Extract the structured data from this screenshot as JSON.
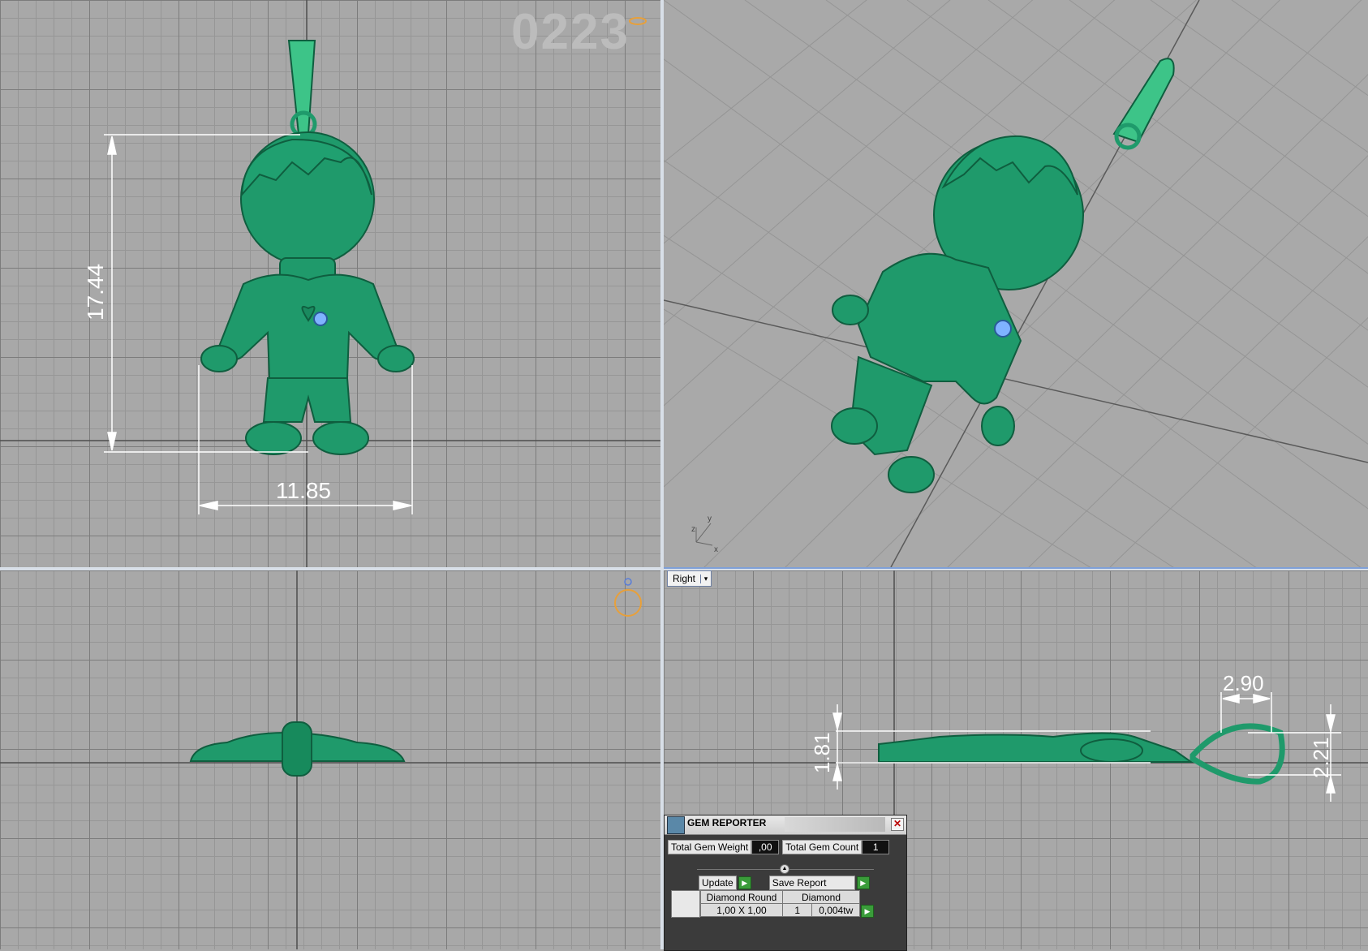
{
  "watermark": "0223",
  "viewports": {
    "front": {
      "dim_height": "17.44",
      "dim_width": "11.85"
    },
    "perspective": {
      "axis_y": "y",
      "axis_z": "z",
      "axis_x": "x"
    },
    "top": {},
    "right": {
      "label": "Right",
      "dim_a": "2.90",
      "dim_b": "1.81",
      "dim_c": "2.21"
    }
  },
  "gem_reporter": {
    "title": "GEM REPORTER",
    "total_weight_label": "Total Gem Weight",
    "total_weight_value": ",00",
    "total_count_label": "Total Gem Count",
    "total_count_value": "1",
    "update_label": "Update",
    "save_label": "Save Report",
    "table": {
      "gem_name": "Diamond Round",
      "gem_type": "Diamond",
      "size": "1,00 X 1,00",
      "qty": "1",
      "weight": "0,004tw"
    }
  },
  "colors": {
    "model": "#1e9e6e",
    "viewport_bg": "#a8a8a8",
    "dim": "#ffffff"
  }
}
